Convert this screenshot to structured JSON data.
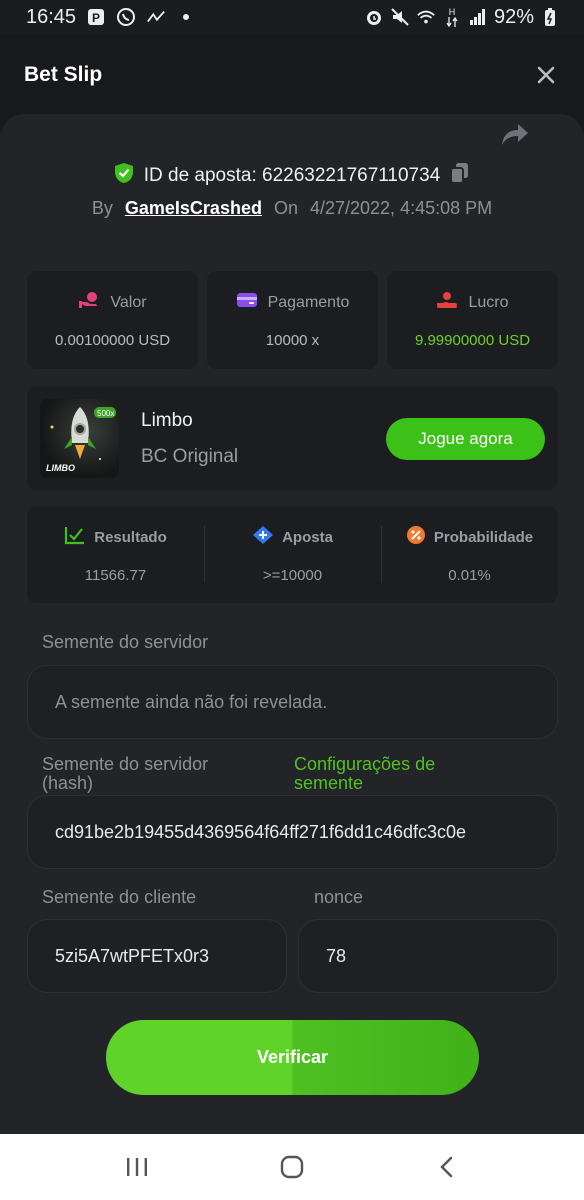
{
  "status_bar": {
    "time": "16:45",
    "battery": "92%",
    "icons": [
      "parking-icon",
      "whatsapp-icon",
      "signal-trend-icon",
      "dot-icon",
      "alarm-icon",
      "mute-icon",
      "wifi-icon",
      "data-arrows-icon",
      "cell-signal-icon",
      "battery-icon"
    ],
    "network_label": "H"
  },
  "header": {
    "title": "Bet Slip",
    "close_icon": "close-icon"
  },
  "bet": {
    "id_label": "ID de aposta: 62263221767110734",
    "by_label": "By",
    "user": "GameIsCrashed",
    "on_label": "On",
    "datetime": "4/27/2022, 4:45:08 PM"
  },
  "stats": [
    {
      "label": "Valor",
      "value": "0.00100000 USD",
      "icon": "money-hand-icon"
    },
    {
      "label": "Pagamento",
      "value": "10000 x",
      "icon": "wallet-icon"
    },
    {
      "label": "Lucro",
      "value": "9.99900000 USD",
      "icon": "profit-hand-icon"
    }
  ],
  "game": {
    "name": "Limbo",
    "provider": "BC Original",
    "thumb_text": "LIMBO",
    "thumb_badge": "500x",
    "play_label": "Jogue agora"
  },
  "result": [
    {
      "label": "Resultado",
      "value": "11566.77",
      "icon": "result-chart-icon"
    },
    {
      "label": "Aposta",
      "value": ">=10000",
      "icon": "bet-tag-icon"
    },
    {
      "label": "Probabilidade",
      "value": "0.01%",
      "icon": "percent-icon"
    }
  ],
  "seeds": {
    "server_label": "Semente do servidor",
    "server_value": "A semente ainda não foi revelada.",
    "server_hash_label": "Semente do servidor (hash)",
    "seed_settings_link": "Configurações de semente",
    "server_hash_value": "cd91be2b19455d4369564f64ff271f6dd1c46dfc3c0e",
    "client_label": "Semente do cliente",
    "client_value": "5zi5A7wtPFETx0r3",
    "nonce_label": "nonce",
    "nonce_value": "78"
  },
  "verify_label": "Verificar",
  "colors": {
    "accent_green": "#3bc117",
    "profit_green": "#6fd12a",
    "background": "#18191d",
    "panel": "#232428"
  }
}
